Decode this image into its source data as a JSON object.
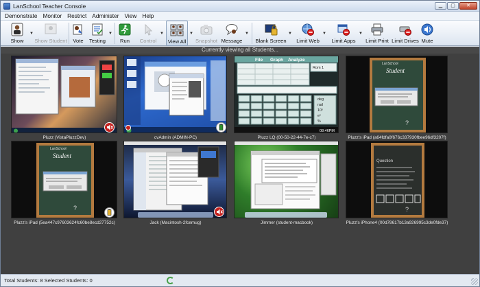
{
  "window": {
    "title": "LanSchool Teacher Console"
  },
  "menu": [
    "Demonstrate",
    "Monitor",
    "Restrict",
    "Administer",
    "View",
    "Help"
  ],
  "toolbar": {
    "show": "Show",
    "show_student": "Show Student",
    "vote": "Vote",
    "testing": "Testing",
    "run": "Run",
    "control": "Control",
    "view_all": "View All",
    "snapshot": "Snapshot",
    "message": "Message",
    "blank_screen": "Blank Screen",
    "limit_web": "Limit Web",
    "limit_apps": "Limit Apps",
    "limit_print": "Limit Print",
    "limit_drives": "Limit Drives",
    "mute": "Mute"
  },
  "viewing_text": "Currently viewing all Students...",
  "students": [
    {
      "label": "Pluzz (VistaPluzzDev)"
    },
    {
      "label": "cvAdmin (ADMIN-PC)"
    },
    {
      "label": "Pluzz LQ (00-50-22-44-7e-c7)"
    },
    {
      "label": "Pluzz's iPad (a64fdfa0f676c337930fbee96df3207f)"
    },
    {
      "label": "Pluzz's iPad (5ea447c97603624fc60be8ecd27752c)"
    },
    {
      "label": "Jack (Macintosh-2fcemug)"
    },
    {
      "label": "Jimmer (student-macbook)"
    },
    {
      "label": "Pluzz's iPhone4 (00d78617b13a926995c3de0fde37)"
    }
  ],
  "thumb_text": {
    "calc_menu": [
      "File",
      "Graph",
      "Analyze"
    ],
    "calc_mode": "Rom 1",
    "calc_keys": [
      "deg",
      "rad",
      "10ˣ",
      "eˣ",
      "%"
    ],
    "calc_time": "08:46PM",
    "ipad_brand": "LanSchool",
    "ipad_title": "Student",
    "question": "Question"
  },
  "status": {
    "text": "Total Students: 8  Selected Students: 0"
  },
  "colors": {
    "accent": "#2a5aa8",
    "status_green": "#49a04a",
    "chalkboard": "#2f4a3b",
    "wood": "#b37a3f"
  }
}
